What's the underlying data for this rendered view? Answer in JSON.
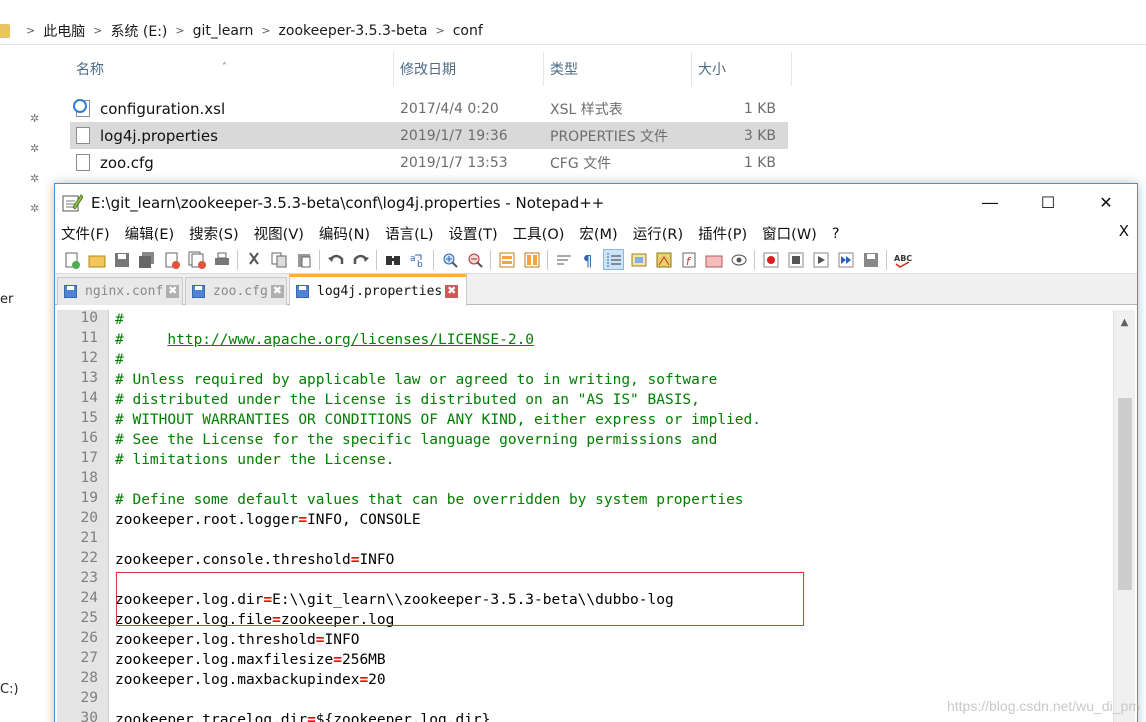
{
  "explorer": {
    "breadcrumbs": [
      "此电脑",
      "系统 (E:)",
      "git_learn",
      "zookeeper-3.5.3-beta",
      "conf"
    ],
    "columns": [
      "名称",
      "修改日期",
      "类型",
      "大小"
    ],
    "files": [
      {
        "name": "configuration.xsl",
        "date": "2017/4/4 0:20",
        "type": "XSL 样式表",
        "size": "1 KB",
        "icon": "xsl-file-icon",
        "selected": false
      },
      {
        "name": "log4j.properties",
        "date": "2019/1/7 19:36",
        "type": "PROPERTIES 文件",
        "size": "3 KB",
        "icon": "file-icon",
        "selected": true
      },
      {
        "name": "zoo.cfg",
        "date": "2019/1/7 13:53",
        "type": "CFG 文件",
        "size": "1 KB",
        "icon": "file-icon",
        "selected": false
      }
    ],
    "side_fragments": [
      "er",
      "C:)"
    ]
  },
  "npp": {
    "title": "E:\\git_learn\\zookeeper-3.5.3-beta\\conf\\log4j.properties - Notepad++",
    "menus": [
      "文件(F)",
      "编辑(E)",
      "搜索(S)",
      "视图(V)",
      "编码(N)",
      "语言(L)",
      "设置(T)",
      "工具(O)",
      "宏(M)",
      "运行(R)",
      "插件(P)",
      "窗口(W)",
      "?"
    ],
    "menu_close": "X",
    "tabs": [
      {
        "label": "nginx.conf",
        "active": false
      },
      {
        "label": "zoo.cfg",
        "active": false
      },
      {
        "label": "log4j.properties",
        "active": true
      }
    ],
    "lines": [
      {
        "n": "10",
        "t": "#"
      },
      {
        "n": "11",
        "t": "#     http://www.apache.org/licenses/LICENSE-2.0"
      },
      {
        "n": "12",
        "t": "#"
      },
      {
        "n": "13",
        "t": "# Unless required by applicable law or agreed to in writing, software"
      },
      {
        "n": "14",
        "t": "# distributed under the License is distributed on an \"AS IS\" BASIS,"
      },
      {
        "n": "15",
        "t": "# WITHOUT WARRANTIES OR CONDITIONS OF ANY KIND, either express or implied."
      },
      {
        "n": "16",
        "t": "# See the License for the specific language governing permissions and"
      },
      {
        "n": "17",
        "t": "# limitations under the License."
      },
      {
        "n": "18",
        "t": ""
      },
      {
        "n": "19",
        "t": "# Define some default values that can be overridden by system properties"
      },
      {
        "n": "20",
        "t": "zookeeper.root.logger=INFO, CONSOLE"
      },
      {
        "n": "21",
        "t": ""
      },
      {
        "n": "22",
        "t": "zookeeper.console.threshold=INFO"
      },
      {
        "n": "23",
        "t": ""
      },
      {
        "n": "24",
        "t": "zookeeper.log.dir=E:\\\\git_learn\\\\zookeeper-3.5.3-beta\\\\dubbo-log"
      },
      {
        "n": "25",
        "t": "zookeeper.log.file=zookeeper.log"
      },
      {
        "n": "26",
        "t": "zookeeper.log.threshold=INFO"
      },
      {
        "n": "27",
        "t": "zookeeper.log.maxfilesize=256MB"
      },
      {
        "n": "28",
        "t": "zookeeper.log.maxbackupindex=20"
      },
      {
        "n": "29",
        "t": ""
      },
      {
        "n": "30",
        "t": "zookeeper.tracelog.dir=${zookeeper.log.dir}"
      }
    ],
    "url": "http://www.apache.org/licenses/LICENSE-2.0"
  },
  "watermark": "https://blog.csdn.net/wu_di_pm",
  "colors": {
    "accent": "#4a8fd6",
    "tab_active": "#fab233",
    "comment": "#008000",
    "operator": "#ff0000",
    "highlight": "#d63a3a"
  }
}
